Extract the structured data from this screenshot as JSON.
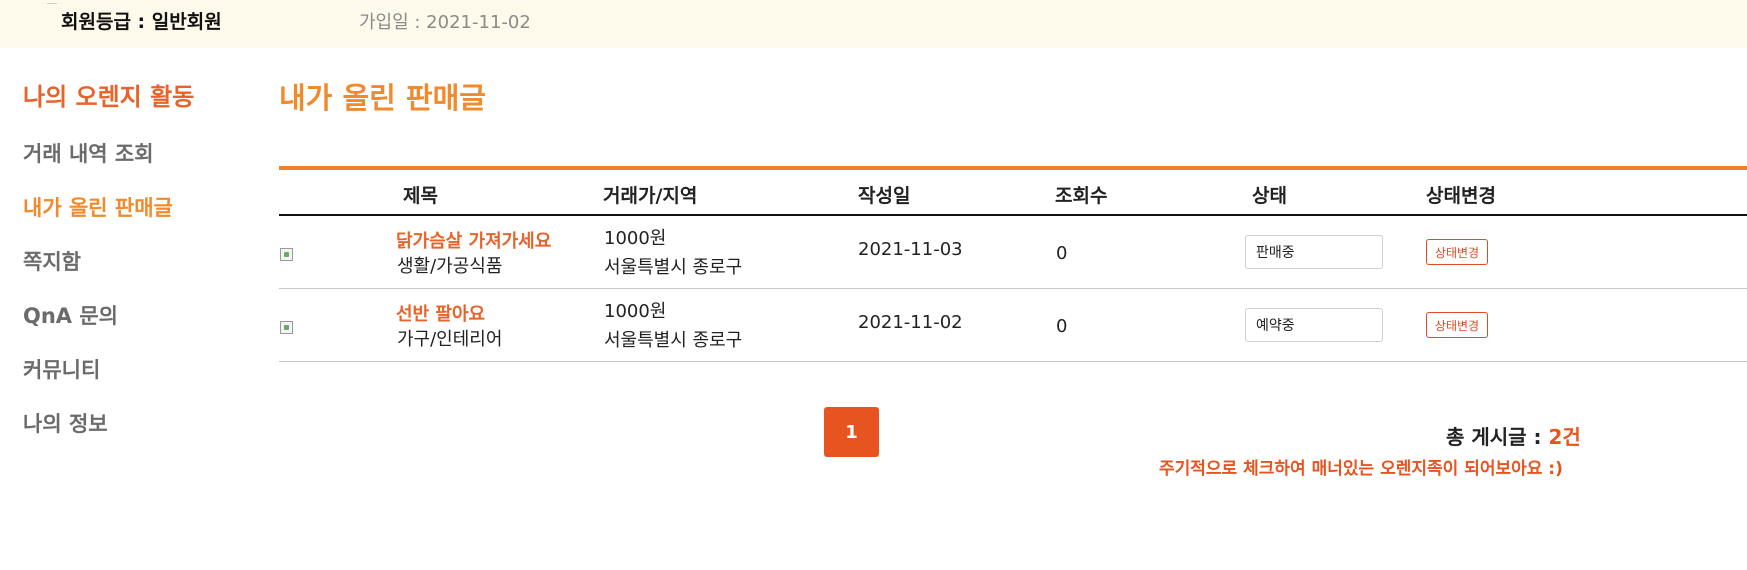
{
  "header": {
    "grade_label": "회원등급 : 일반회원",
    "joined_label": "가입일 : 2021-11-02"
  },
  "sidebar": {
    "title": "나의 오렌지 활동",
    "items": [
      {
        "label": "거래 내역 조회"
      },
      {
        "label": "내가 올린 판매글"
      },
      {
        "label": "쪽지함"
      },
      {
        "label": "QnA 문의"
      },
      {
        "label": "커뮤니티"
      },
      {
        "label": "나의 정보"
      }
    ]
  },
  "main": {
    "title": "내가 올린 판매글",
    "columns": [
      "제목",
      "거래가/지역",
      "작성일",
      "조회수",
      "상태",
      "상태변경"
    ],
    "rows": [
      {
        "title": "닭가슴살 가져가세요",
        "category": "생활/가공식품",
        "price": "1000원",
        "region": "서울특별시 종로구",
        "date": "2021-11-03",
        "views": "0",
        "status": "판매중",
        "change_label": "상태변경"
      },
      {
        "title": "선반 팔아요",
        "category": "가구/인테리어",
        "price": "1000원",
        "region": "서울특별시 종로구",
        "date": "2021-11-02",
        "views": "0",
        "status": "예약중",
        "change_label": "상태변경"
      }
    ]
  },
  "pagination": {
    "current_page": "1"
  },
  "footer": {
    "total_label": "총 게시글 : ",
    "total_count": "2건",
    "notice": "주기적으로 체크하여 매너있는 오렌지족이 되어보아요 :)"
  },
  "colors": {
    "accent_orange": "#f08a2a",
    "accent_red": "#e8541f",
    "header_bg": "#fdfaeb"
  }
}
